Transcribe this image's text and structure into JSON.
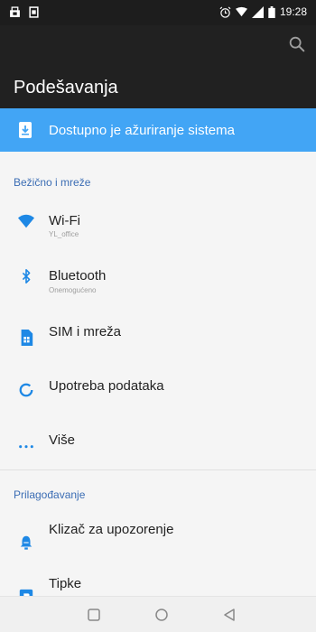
{
  "status_bar": {
    "time": "19:28",
    "left_icons": [
      "notification-icon",
      "sim-notification-icon"
    ],
    "right_icons": [
      "alarm-icon",
      "wifi-signal-icon",
      "cell-signal-icon",
      "battery-icon"
    ]
  },
  "toolbar": {
    "title": "Podešavanja",
    "search_icon": "search-icon"
  },
  "banner": {
    "text": "Dostupno je ažuriranje sistema",
    "icon": "system-update-icon",
    "color": "#42a5f5"
  },
  "sections": [
    {
      "header": "Bežično i mreže",
      "items": [
        {
          "label": "Wi-Fi",
          "sub": "YL_office",
          "icon": "wifi-icon"
        },
        {
          "label": "Bluetooth",
          "sub": "Onemogućeno",
          "icon": "bluetooth-icon"
        },
        {
          "label": "SIM i mreža",
          "sub": "",
          "icon": "sim-card-icon"
        },
        {
          "label": "Upotreba podataka",
          "sub": "",
          "icon": "data-usage-icon"
        },
        {
          "label": "Više",
          "sub": "",
          "icon": "more-icon"
        }
      ]
    },
    {
      "header": "Prilagođavanje",
      "items": [
        {
          "label": "Klizač za upozorenje",
          "sub": "",
          "icon": "alert-slider-icon"
        },
        {
          "label": "Tipke",
          "sub": "",
          "icon": "buttons-icon"
        }
      ]
    }
  ],
  "nav_bar": {
    "icons": [
      "recents-icon",
      "home-icon",
      "back-icon"
    ]
  },
  "colors": {
    "accent": "#42a5f5",
    "section_header": "#3b6db4",
    "icon": "#1e88e5"
  }
}
